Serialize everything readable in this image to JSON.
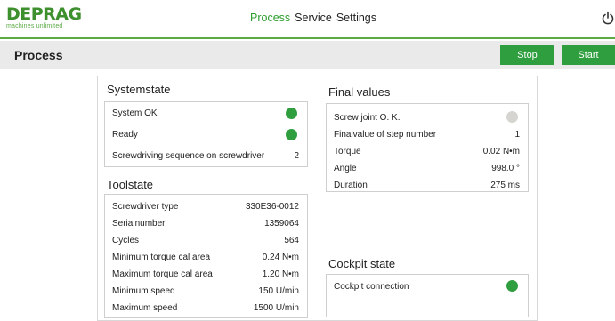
{
  "header": {
    "logo_main": "DEPRAG",
    "logo_sub": "machines unlimited",
    "nav": [
      "Process",
      "Service",
      "Settings"
    ],
    "active_nav": "Process",
    "power_icon": "power-icon"
  },
  "titlebar": {
    "title": "Process",
    "stop_label": "Stop",
    "start_label": "Start",
    "accent": "#2e9e3e"
  },
  "systemstate": {
    "title": "Systemstate",
    "system_ok": "System OK",
    "system_ok_status": "green",
    "ready": "Ready",
    "ready_status": "green",
    "sequence_label": "Screwdriving sequence on screwdriver",
    "sequence_value": "2"
  },
  "toolstate": {
    "title": "Toolstate",
    "rows": [
      {
        "label": "Screwdriver type",
        "value": "330E36-0012"
      },
      {
        "label": "Serialnumber",
        "value": "1359064"
      },
      {
        "label": "Cycles",
        "value": "564"
      },
      {
        "label": "Minimum torque cal area",
        "value": "0.24 N•m"
      },
      {
        "label": "Maximum torque cal area",
        "value": "1.20 N•m"
      },
      {
        "label": "Minimum speed",
        "value": "150 U/min"
      },
      {
        "label": "Maximum speed",
        "value": "1500 U/min"
      }
    ]
  },
  "final_values": {
    "title": "Final values",
    "screw_joint_label": "Screw joint O. K.",
    "screw_joint_status": "grey",
    "rows": [
      {
        "label": "Finalvalue of step number",
        "value": "1"
      },
      {
        "label": "Torque",
        "value": "0.02 N•m"
      },
      {
        "label": "Angle",
        "value": "998.0 °"
      },
      {
        "label": "Duration",
        "value": "275 ms"
      }
    ]
  },
  "cockpit": {
    "title": "Cockpit state",
    "connection_label": "Cockpit connection",
    "connection_status": "green"
  }
}
